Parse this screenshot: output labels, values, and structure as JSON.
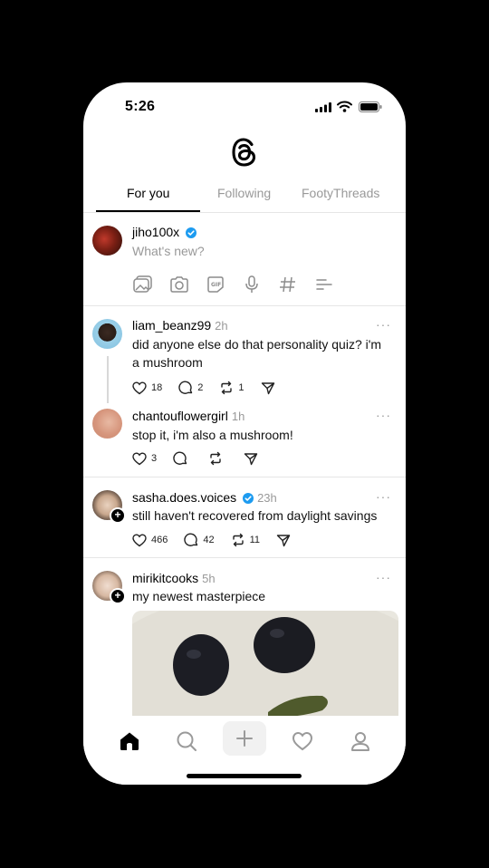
{
  "status_bar": {
    "time": "5:26"
  },
  "tabs": [
    {
      "label": "For you",
      "active": true
    },
    {
      "label": "Following",
      "active": false
    },
    {
      "label": "FootyThreads",
      "active": false
    }
  ],
  "composer": {
    "username": "jiho100x",
    "verified": true,
    "placeholder": "What's new?",
    "tools": [
      "gallery-icon",
      "camera-icon",
      "gif-icon",
      "microphone-icon",
      "hashtag-icon",
      "poll-icon"
    ]
  },
  "posts": [
    {
      "username": "liam_beanz99",
      "time": "2h",
      "text": "did anyone else do that personality quiz? i'm a mushroom",
      "likes": "18",
      "replies": "2",
      "reposts": "1"
    },
    {
      "username": "chantouflowergirl",
      "time": "1h",
      "text": "stop it, i'm also a mushroom!",
      "likes": "3",
      "replies": "",
      "reposts": ""
    },
    {
      "username": "sasha.does.voices",
      "verified": true,
      "time": "23h",
      "text": "still haven't recovered from daylight savings",
      "likes": "466",
      "replies": "42",
      "reposts": "11"
    },
    {
      "username": "mirikitcooks",
      "time": "5h",
      "text": "my newest masterpiece"
    }
  ],
  "more_glyph": "···",
  "nav": [
    "home-icon",
    "search-icon",
    "create-icon",
    "activity-heart-icon",
    "profile-icon"
  ],
  "colors": {
    "verified": "#1d9bf0",
    "muted": "#999999",
    "divider": "#e6e6e6"
  }
}
